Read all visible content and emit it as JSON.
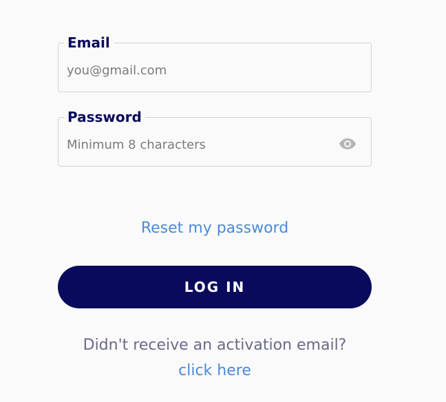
{
  "form": {
    "email": {
      "label": "Email",
      "placeholder": "you@gmail.com",
      "value": ""
    },
    "password": {
      "label": "Password",
      "placeholder": "Minimum 8 characters",
      "value": "",
      "toggle_icon": "eye-icon"
    },
    "reset_link": "Reset my password",
    "login_button": "LOG IN",
    "activation_prompt": "Didn't receive an activation email?",
    "activation_link": "click here"
  },
  "colors": {
    "background": "#fafafa",
    "label": "#0a0a5c",
    "button_bg": "#0a0a5c",
    "button_text": "#ffffff",
    "link": "#4a8ad8",
    "muted_text": "#6a6a8a",
    "border": "#d3d3d6",
    "icon": "#b5b5b5"
  }
}
